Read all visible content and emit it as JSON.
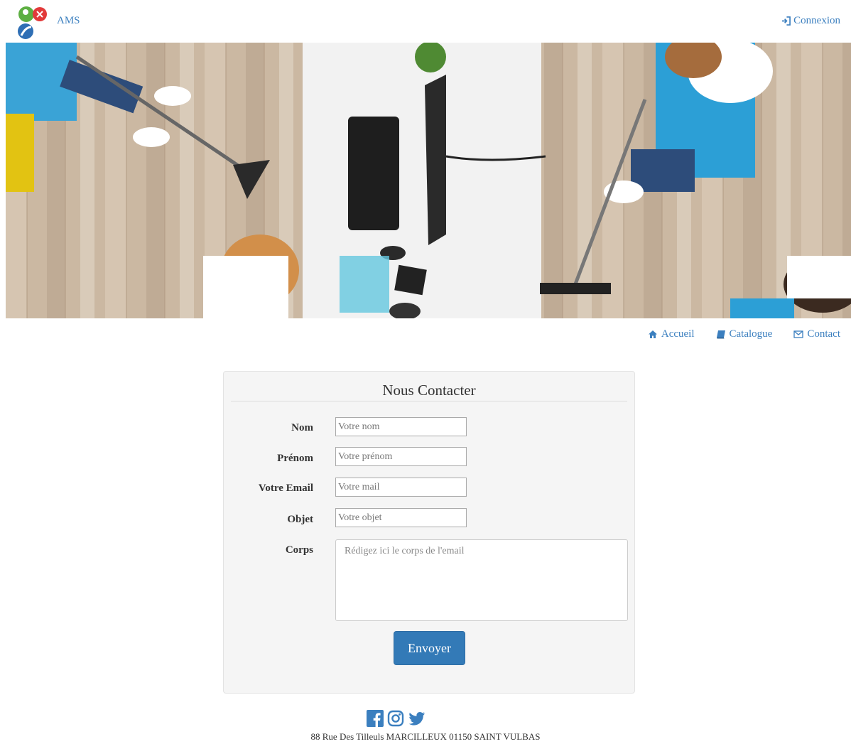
{
  "header": {
    "brand": "AMS",
    "login_label": "Connexion"
  },
  "nav": {
    "items": [
      {
        "label": "Accueil",
        "icon": "home-icon"
      },
      {
        "label": "Catalogue",
        "icon": "book-icon"
      },
      {
        "label": "Contact",
        "icon": "envelope-icon"
      }
    ]
  },
  "form": {
    "title": "Nous Contacter",
    "fields": [
      {
        "label": "Nom",
        "placeholder": "Votre nom"
      },
      {
        "label": "Prénom",
        "placeholder": "Votre prénom"
      },
      {
        "label": "Votre Email",
        "placeholder": "Votre mail"
      },
      {
        "label": "Objet",
        "placeholder": "Votre objet"
      }
    ],
    "body_label": "Corps",
    "body_placeholder": "Rédigez ici le corps de l'email",
    "submit_label": "Envoyer"
  },
  "footer": {
    "social": [
      "facebook-icon",
      "instagram-icon",
      "twitter-icon"
    ],
    "address": "88 Rue Des Tilleuls MARCILLEUX 01150 SAINT VULBAS"
  },
  "colors": {
    "accent": "#337ab7",
    "link": "#3b7fbf",
    "panel_bg": "#f5f5f5"
  }
}
